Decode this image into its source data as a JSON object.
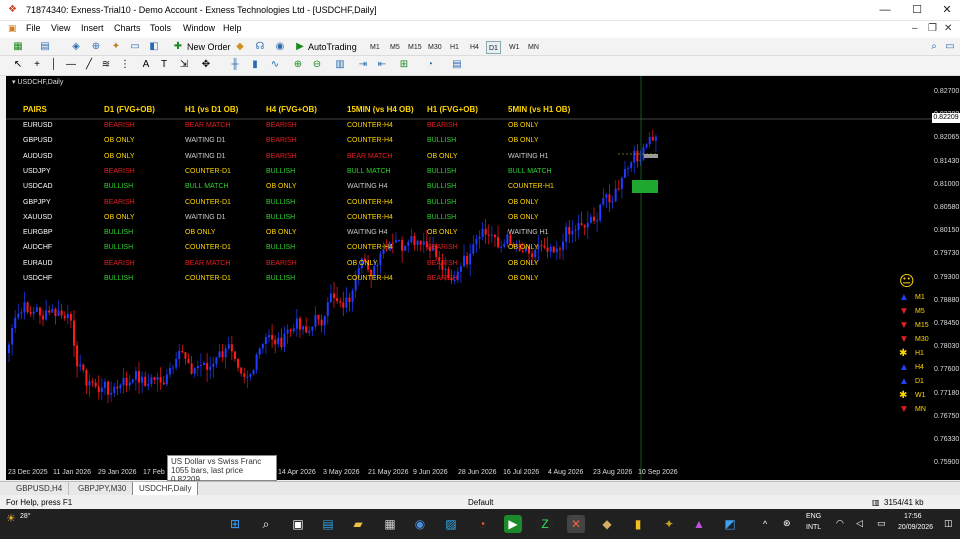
{
  "window": {
    "title": "71874340: Exness-Trial10 - Demo Account - Exness Technologies Ltd - [USDCHF,Daily]",
    "minimize": "—",
    "maximize": "☐",
    "close": "✕"
  },
  "menu": [
    "File",
    "View",
    "Insert",
    "Charts",
    "Tools",
    "Window",
    "Help"
  ],
  "toolbar": {
    "new_order": "New Order",
    "autotrading": "AutoTrading",
    "timeframes": [
      "M1",
      "M5",
      "M15",
      "M30",
      "H1",
      "H4",
      "D1",
      "W1",
      "MN"
    ],
    "active_timeframe": "D1"
  },
  "chart": {
    "symbol_label": "USDCHF,Daily",
    "last_price_tag": "0.82209",
    "price_axis": [
      "0.82700",
      "0.82380",
      "0.82065",
      "0.81430",
      "0.81000",
      "0.80580",
      "0.80150",
      "0.79730",
      "0.79300",
      "0.78880",
      "0.78450",
      "0.78030",
      "0.77600",
      "0.77180",
      "0.76750",
      "0.76330",
      "0.75900"
    ],
    "date_axis": [
      "23 Dec 2025",
      "11 Jan 2026",
      "29 Jan 2026",
      "17 Feb 2",
      "14 Apr 2026",
      "3 May 2026",
      "21 May 2026",
      "9 Jun 2026",
      "28 Jun 2026",
      "16 Jul 2026",
      "4 Aug 2026",
      "23 Aug 2026",
      "10 Sep 2026"
    ],
    "tooltip": {
      "line1": "US Dollar vs Swiss Franc",
      "line2": "1055 bars, last price 0.82209"
    }
  },
  "dashboard": {
    "headers": [
      "PAIRS",
      "D1 (FVG+OB)",
      "H1 (vs D1 OB)",
      "H4 (FVG+OB)",
      "15MIN (vs H4 OB)",
      "H1 (FVG+OB)",
      "5MIN (vs H1 OB)"
    ],
    "rows": [
      {
        "pair": "EURUSD",
        "cells": [
          [
            "BEARISH",
            "#e02020"
          ],
          [
            "BEAR MATCH",
            "#e02020"
          ],
          [
            "BEARISH",
            "#e02020"
          ],
          [
            "COUNTER-H4",
            "#ffd700"
          ],
          [
            "BEARISH",
            "#e02020"
          ],
          [
            "OB ONLY",
            "#ffd700"
          ]
        ]
      },
      {
        "pair": "GBPUSD",
        "cells": [
          [
            "OB ONLY",
            "#ffd700"
          ],
          [
            "WAITING D1",
            "#cccccc"
          ],
          [
            "BEARISH",
            "#e02020"
          ],
          [
            "COUNTER-H4",
            "#ffd700"
          ],
          [
            "BULLISH",
            "#30d030"
          ],
          [
            "OB ONLY",
            "#ffd700"
          ]
        ]
      },
      {
        "pair": "AUDUSD",
        "cells": [
          [
            "OB ONLY",
            "#ffd700"
          ],
          [
            "WAITING D1",
            "#cccccc"
          ],
          [
            "BEARISH",
            "#e02020"
          ],
          [
            "BEAR MATCH",
            "#e02020"
          ],
          [
            "OB ONLY",
            "#ffd700"
          ],
          [
            "WAITING H1",
            "#cccccc"
          ]
        ]
      },
      {
        "pair": "USDJPY",
        "cells": [
          [
            "BEARISH",
            "#e02020"
          ],
          [
            "COUNTER-D1",
            "#ffd700"
          ],
          [
            "BULLISH",
            "#30d030"
          ],
          [
            "BULL MATCH",
            "#30d030"
          ],
          [
            "BULLISH",
            "#30d030"
          ],
          [
            "BULL MATCH",
            "#30d030"
          ]
        ]
      },
      {
        "pair": "USDCAD",
        "cells": [
          [
            "BULLISH",
            "#30d030"
          ],
          [
            "BULL MATCH",
            "#30d030"
          ],
          [
            "OB ONLY",
            "#ffd700"
          ],
          [
            "WAITING H4",
            "#cccccc"
          ],
          [
            "BULLISH",
            "#30d030"
          ],
          [
            "COUNTER-H1",
            "#ffd700"
          ]
        ]
      },
      {
        "pair": "GBPJPY",
        "cells": [
          [
            "BEARISH",
            "#e02020"
          ],
          [
            "COUNTER-D1",
            "#ffd700"
          ],
          [
            "BULLISH",
            "#30d030"
          ],
          [
            "COUNTER-H4",
            "#ffd700"
          ],
          [
            "BULLISH",
            "#30d030"
          ],
          [
            "OB ONLY",
            "#ffd700"
          ]
        ]
      },
      {
        "pair": "XAUUSD",
        "cells": [
          [
            "OB ONLY",
            "#ffd700"
          ],
          [
            "WAITING D1",
            "#cccccc"
          ],
          [
            "BULLISH",
            "#30d030"
          ],
          [
            "COUNTER-H4",
            "#ffd700"
          ],
          [
            "BULLISH",
            "#30d030"
          ],
          [
            "OB ONLY",
            "#ffd700"
          ]
        ]
      },
      {
        "pair": "EURGBP",
        "cells": [
          [
            "BULLISH",
            "#30d030"
          ],
          [
            "OB ONLY",
            "#ffd700"
          ],
          [
            "OB ONLY",
            "#ffd700"
          ],
          [
            "WAITING H4",
            "#cccccc"
          ],
          [
            "OB ONLY",
            "#ffd700"
          ],
          [
            "WAITING H1",
            "#cccccc"
          ]
        ]
      },
      {
        "pair": "AUDCHF",
        "cells": [
          [
            "BULLISH",
            "#30d030"
          ],
          [
            "COUNTER-D1",
            "#ffd700"
          ],
          [
            "BULLISH",
            "#30d030"
          ],
          [
            "COUNTER-H4",
            "#ffd700"
          ],
          [
            "BEARISH",
            "#e02020"
          ],
          [
            "OB ONLY",
            "#ffd700"
          ]
        ]
      },
      {
        "pair": "EURAUD",
        "cells": [
          [
            "BEARISH",
            "#e02020"
          ],
          [
            "BEAR MATCH",
            "#e02020"
          ],
          [
            "BEARISH",
            "#e02020"
          ],
          [
            "OB ONLY",
            "#ffd700"
          ],
          [
            "BEARISH",
            "#e02020"
          ],
          [
            "OB ONLY",
            "#ffd700"
          ]
        ]
      },
      {
        "pair": "USDCHF",
        "cells": [
          [
            "BULLISH",
            "#30d030"
          ],
          [
            "COUNTER-D1",
            "#ffd700"
          ],
          [
            "BULLISH",
            "#30d030"
          ],
          [
            "COUNTER-H4",
            "#ffd700"
          ],
          [
            "BEARISH",
            "#e02020"
          ],
          [
            "OB ONLY",
            "#ffd700"
          ]
        ]
      }
    ]
  },
  "indicator_panel": {
    "face": "😐",
    "items": [
      {
        "tf": "M1",
        "dir": "up",
        "color": "#2040ff"
      },
      {
        "tf": "M5",
        "dir": "down",
        "color": "#e02020"
      },
      {
        "tf": "M15",
        "dir": "down",
        "color": "#e02020"
      },
      {
        "tf": "M30",
        "dir": "down",
        "color": "#e02020"
      },
      {
        "tf": "H1",
        "dir": "neutral",
        "color": "#ffd700"
      },
      {
        "tf": "H4",
        "dir": "up",
        "color": "#2040ff"
      },
      {
        "tf": "D1",
        "dir": "up",
        "color": "#2040ff"
      },
      {
        "tf": "W1",
        "dir": "neutral",
        "color": "#ffd700"
      },
      {
        "tf": "MN",
        "dir": "down",
        "color": "#e02020"
      }
    ]
  },
  "tabs": [
    "GBPUSD,H4",
    "GBPJPY,M30",
    "USDCHF,Daily"
  ],
  "active_tab": "USDCHF,Daily",
  "status": {
    "help": "For Help, press F1",
    "profile": "Default",
    "traffic": "3154/41 kb"
  },
  "taskbar": {
    "weather": "28°",
    "language": "ENG",
    "layout": "INTL",
    "time": "17:56",
    "date": "20/09/2026"
  },
  "colors": {
    "bull_candle": "#1f3cff",
    "bear_candle": "#ff1a1a",
    "chart_bg": "#000000",
    "header_gold": "#ffd700"
  }
}
